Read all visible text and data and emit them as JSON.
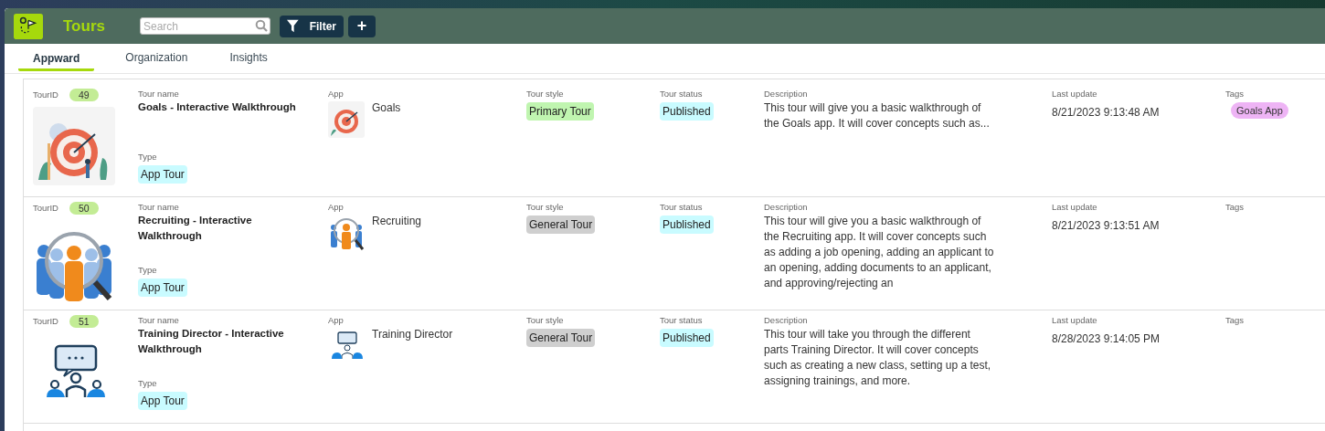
{
  "header": {
    "title": "Tours",
    "search": {
      "placeholder": "Search"
    },
    "filter_button": "Filter",
    "add_button": "+"
  },
  "tabs": [
    {
      "label": "Appward",
      "selected": true
    },
    {
      "label": "Organization",
      "selected": false
    },
    {
      "label": "Insights",
      "selected": false
    }
  ],
  "tours": [
    {
      "kind": "goals",
      "labels": {
        "id": "TourID",
        "name": "Tour name",
        "type": "Type",
        "app": "App",
        "style": "Tour style",
        "status": "Tour status",
        "description": "Description",
        "updated": "Last update",
        "tags": "Tags"
      },
      "id": "49",
      "name": "Goals - Interactive Walkthrough",
      "type": "App Tour",
      "app": "Goals",
      "style": {
        "label": "Primary Tour",
        "kind": "primary"
      },
      "status": "Published",
      "description": "This tour will give you a basic walkthrough of the Goals app. It will cover concepts such as...",
      "updated": "8/21/2023 9:13:48 AM",
      "tags": [
        {
          "label": "Goals App",
          "color": "#eeb4f5"
        }
      ]
    },
    {
      "kind": "recruiting",
      "labels": {
        "id": "TourID",
        "name": "Tour name",
        "type": "Type",
        "app": "App",
        "style": "Tour style",
        "status": "Tour status",
        "description": "Description",
        "updated": "Last update",
        "tags": "Tags"
      },
      "id": "50",
      "name": "Recruiting - Interactive Walkthrough",
      "type": "App Tour",
      "app": "Recruiting",
      "style": {
        "label": "General Tour",
        "kind": "general"
      },
      "status": "Published",
      "description": "This tour will give you a basic walkthrough of the Recruiting app. It will cover concepts such as adding a job opening, adding an applicant to an opening, adding documents to an applicant, and approving/rejecting an",
      "updated": "8/21/2023 9:13:51 AM"
    },
    {
      "kind": "training",
      "labels": {
        "id": "TourID",
        "name": "Tour name",
        "type": "Type",
        "app": "App",
        "style": "Tour style",
        "status": "Tour status",
        "description": "Description",
        "updated": "Last update",
        "tags": "Tags"
      },
      "id": "51",
      "name": "Training Director - Interactive Walkthrough",
      "type": "App Tour",
      "app": "Training Director",
      "style": {
        "label": "General Tour",
        "kind": "general"
      },
      "status": "Published",
      "description": "This tour will take you through the different parts Training Director. It will cover concepts such as creating a new class, setting up a test, assigning trainings, and more.",
      "updated": "8/28/2023 9:14:05 PM"
    }
  ]
}
